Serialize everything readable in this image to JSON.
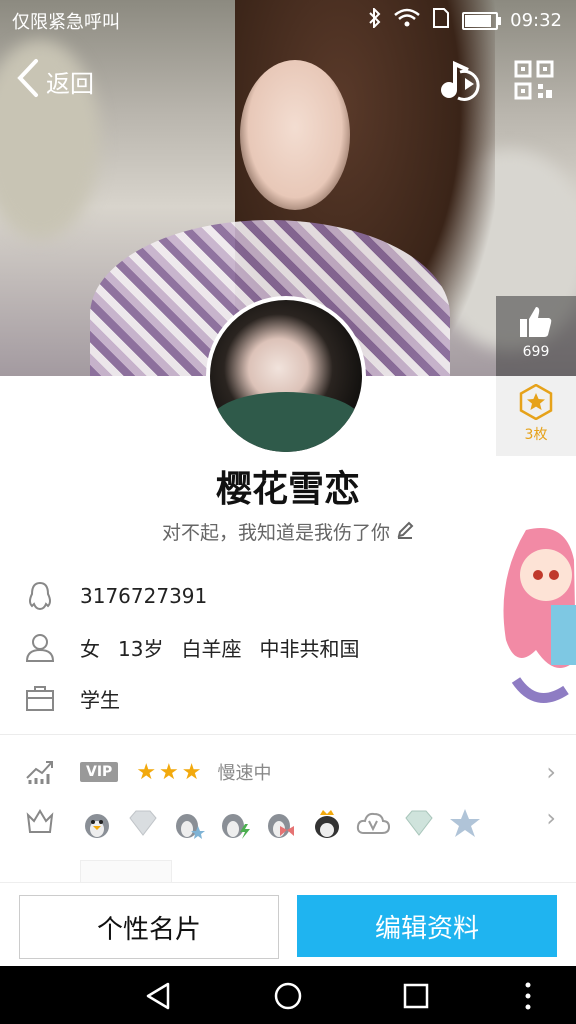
{
  "status": {
    "carrier": "仅限紧急呼叫",
    "time": "09:32",
    "battery_level": 0.8
  },
  "topbar": {
    "back_label": "返回",
    "music_icon": "music-note-icon",
    "qr_icon": "qr-code-icon"
  },
  "likes": {
    "count": "699"
  },
  "stars": {
    "label": "3枚"
  },
  "profile": {
    "nickname": "樱花雪恋",
    "signature": "对不起，我知道是我伤了你"
  },
  "info": {
    "qq": "3176727391",
    "gender": "女",
    "age": "13岁",
    "zodiac": "白羊座",
    "country": "中非共和国",
    "job": "学生"
  },
  "vip": {
    "badge": "VIP",
    "stars": 3,
    "status": "慢速中"
  },
  "badges": [
    "penguin-icon",
    "diamond-icon",
    "penguin-star-icon",
    "penguin-lightning-icon",
    "penguin-bow-icon",
    "penguin-crown-icon",
    "cloud-v-icon",
    "diamond-green-icon",
    "star-badge-icon"
  ],
  "actions": {
    "card_label": "个性名片",
    "edit_label": "编辑资料"
  },
  "colors": {
    "accent": "#1fb4f0",
    "star": "#e6a21a"
  }
}
